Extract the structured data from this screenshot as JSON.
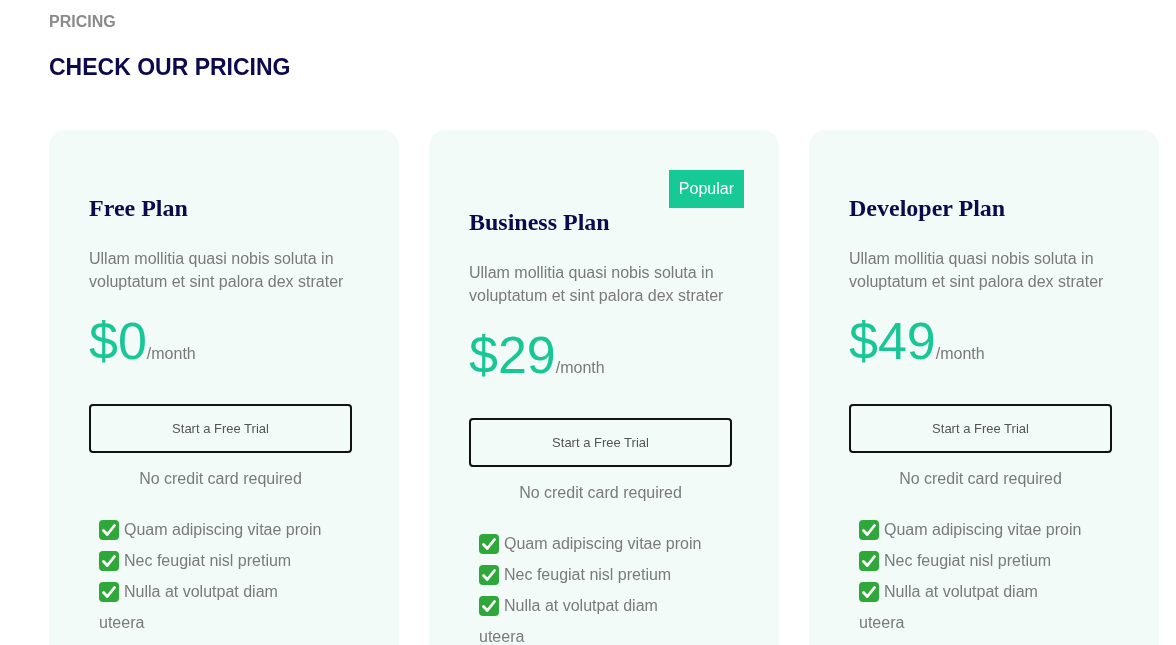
{
  "section": {
    "eyebrow": "PRICING",
    "title": "CHECK OUR PRICING"
  },
  "plans": [
    {
      "name": "Free Plan",
      "description": "Ullam mollitia quasi nobis soluta in voluptatum et sint palora dex strater",
      "price": "$0",
      "period": "/month",
      "button": "Start a Free Trial",
      "note": "No credit card required",
      "features": [
        {
          "text": "Quam adipiscing vitae proin",
          "checked": true
        },
        {
          "text": "Nec feugiat nisl pretium",
          "checked": true
        },
        {
          "text": "Nulla at volutpat diam",
          "checked": true
        },
        {
          "text": "uteera",
          "checked": false
        }
      ]
    },
    {
      "name": "Business Plan",
      "badge": "Popular",
      "description": "Ullam mollitia quasi nobis soluta in voluptatum et sint palora dex strater",
      "price": "$29",
      "period": "/month",
      "button": "Start a Free Trial",
      "note": "No credit card required",
      "features": [
        {
          "text": "Quam adipiscing vitae proin",
          "checked": true
        },
        {
          "text": "Nec feugiat nisl pretium",
          "checked": true
        },
        {
          "text": "Nulla at volutpat diam",
          "checked": true
        },
        {
          "text": "uteera",
          "checked": false
        }
      ]
    },
    {
      "name": "Developer Plan",
      "description": "Ullam mollitia quasi nobis soluta in voluptatum et sint palora dex strater",
      "price": "$49",
      "period": "/month",
      "button": "Start a Free Trial",
      "note": "No credit card required",
      "features": [
        {
          "text": "Quam adipiscing vitae proin",
          "checked": true
        },
        {
          "text": "Nec feugiat nisl pretium",
          "checked": true
        },
        {
          "text": "Nulla at volutpat diam",
          "checked": true
        },
        {
          "text": "uteera",
          "checked": false
        }
      ]
    }
  ]
}
